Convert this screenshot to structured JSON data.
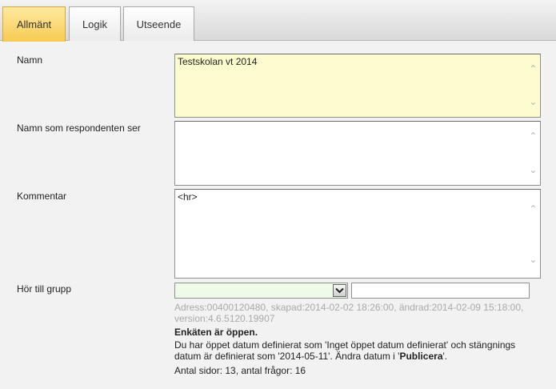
{
  "tabs": [
    {
      "label": "Allmänt",
      "active": true
    },
    {
      "label": "Logik",
      "active": false
    },
    {
      "label": "Utseende",
      "active": false
    }
  ],
  "form": {
    "name_label": "Namn",
    "name_value": "Testskolan vt 2014",
    "respondent_name_label": "Namn som respondenten ser",
    "respondent_name_value": "",
    "comment_label": "Kommentar",
    "comment_value": "<hr>",
    "group_label": "Hör till grupp",
    "group_selected": "",
    "group_text_value": ""
  },
  "info": {
    "meta": "Adress:00400120480, skapad:2014-02-02 18:26:00, ändrad:2014-02-09 15:18:00, version:4.6.5120.19907",
    "status_title": "Enkäten är öppen.",
    "status_desc_part1": "Du har öppet datum definierat som 'Inget öppet datum definierat' och stängnings datum är definierat som '2014-05-11'. Ändra datum i '",
    "status_desc_link": "Publicera",
    "status_desc_part2": "'.",
    "counts": "Antal sidor: 13, antal frågor: 16"
  },
  "colors": {
    "active_tab": "#f7cb52",
    "name_field_bg": "#fdfccf",
    "group_select_bg": "#eefbe8",
    "meta_text": "#a9a9a9"
  }
}
